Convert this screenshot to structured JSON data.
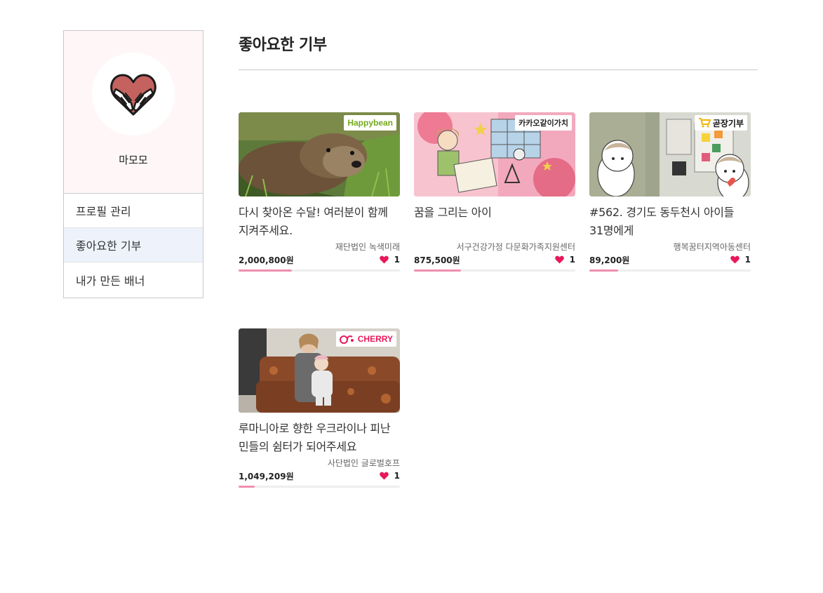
{
  "sidebar": {
    "nickname": "마모모",
    "menu": [
      {
        "label": "프로필 관리",
        "active": false
      },
      {
        "label": "좋아요한 기부",
        "active": true
      },
      {
        "label": "내가 만든 배너",
        "active": false
      }
    ]
  },
  "main": {
    "title": "좋아요한 기부",
    "cards": [
      {
        "title": "다시 찾아온 수달! 여러분이 함께 지켜주세요.",
        "org": "재단법인 녹색미래",
        "amount": "2,000,800원",
        "likes": "1",
        "platform": "Happybean",
        "progress": 0.33
      },
      {
        "title": "꿈을 그리는 아이",
        "org": "서구건강가정 다문화가족지원센터",
        "amount": "875,500원",
        "likes": "1",
        "platform": "카카오같이가치",
        "progress": 0.29
      },
      {
        "title": "#562. 경기도 동두천시 아이들 31명에게",
        "org": "행복꿈터지역아동센터",
        "amount": "89,200원",
        "likes": "1",
        "platform": "곧장기부",
        "progress": 0.18
      },
      {
        "title": "루마니아로 향한 우크라이나 피난민들의 쉼터가 되어주세요",
        "org": "사단법인 글로벌호프",
        "amount": "1,049,209원",
        "likes": "1",
        "platform": "CHERRY",
        "progress": 0.1
      }
    ]
  },
  "colors": {
    "accent_pink": "#ef8fb0",
    "heart": "#e8195a",
    "profile_bg": "#fff7f7",
    "active_menu_bg": "#eef3fb"
  }
}
